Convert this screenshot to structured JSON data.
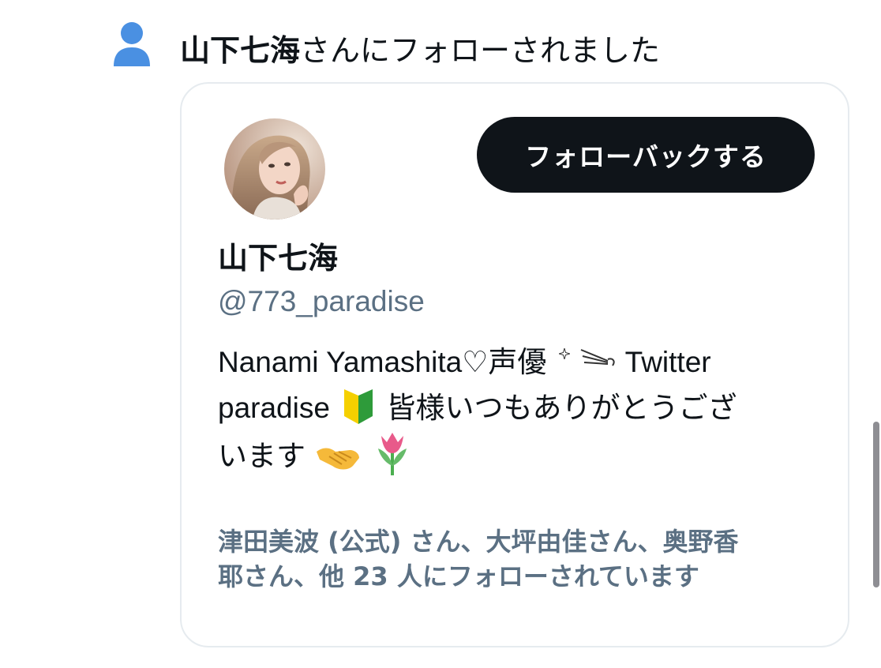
{
  "notification": {
    "icon": "person-icon",
    "actor_name": "山下七海",
    "action_text": "さんにフォローされました"
  },
  "card": {
    "avatar_alt": "avatar",
    "follow_back_label": "フォローバックする",
    "display_name": "山下七海",
    "handle": "@773_paradise",
    "bio": {
      "line1_a": "Nanami Yamashita♡声優",
      "line1_b": "Twitter",
      "line2_a": "paradise",
      "line2_b": "皆様いつもありがとうござ",
      "line3": "います"
    },
    "followed_by": {
      "line1": "津田美波 (公式) さん、大坪由佳さん、奥野香",
      "line2": "耶さん、他 23 人にフォローされています"
    }
  },
  "colors": {
    "accent_blue": "#4a90e2",
    "button_bg": "#0f1419",
    "secondary_text": "#5b7083",
    "card_border": "#e6ebef"
  }
}
